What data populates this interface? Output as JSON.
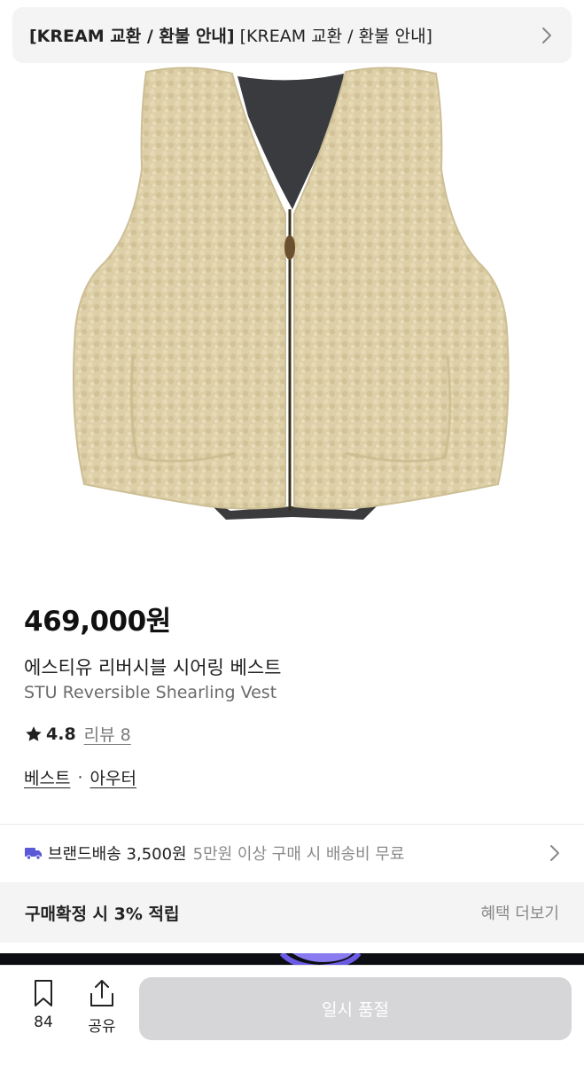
{
  "notice": {
    "title": "[KREAM 교환 / 환불 안내]",
    "text": "[KREAM 교환 / 환불 안내]"
  },
  "product": {
    "price": "469,000원",
    "name_ko": "에스티유 리버시블 시어링 베스트",
    "name_en": "STU Reversible Shearling Vest",
    "rating": "4.8",
    "review_label": "리뷰 8",
    "categories": [
      "베스트",
      "아우터"
    ],
    "category_separator": "·",
    "image_alt": "beige shearling vest"
  },
  "shipping": {
    "label": "브랜드배송 3,500원",
    "condition": "5만원 이상 구매 시 배송비 무료"
  },
  "points": {
    "label": "구매확정 시 3% 적립",
    "more": "혜택 더보기"
  },
  "bottom_bar": {
    "bookmark_count": "84",
    "share_label": "공유",
    "buy_label": "일시 품절"
  },
  "colors": {
    "background": "#ffffff",
    "panel": "#f4f4f5",
    "disabled_button": "#d6d6d8",
    "truck_icon": "#5a5ad8"
  }
}
